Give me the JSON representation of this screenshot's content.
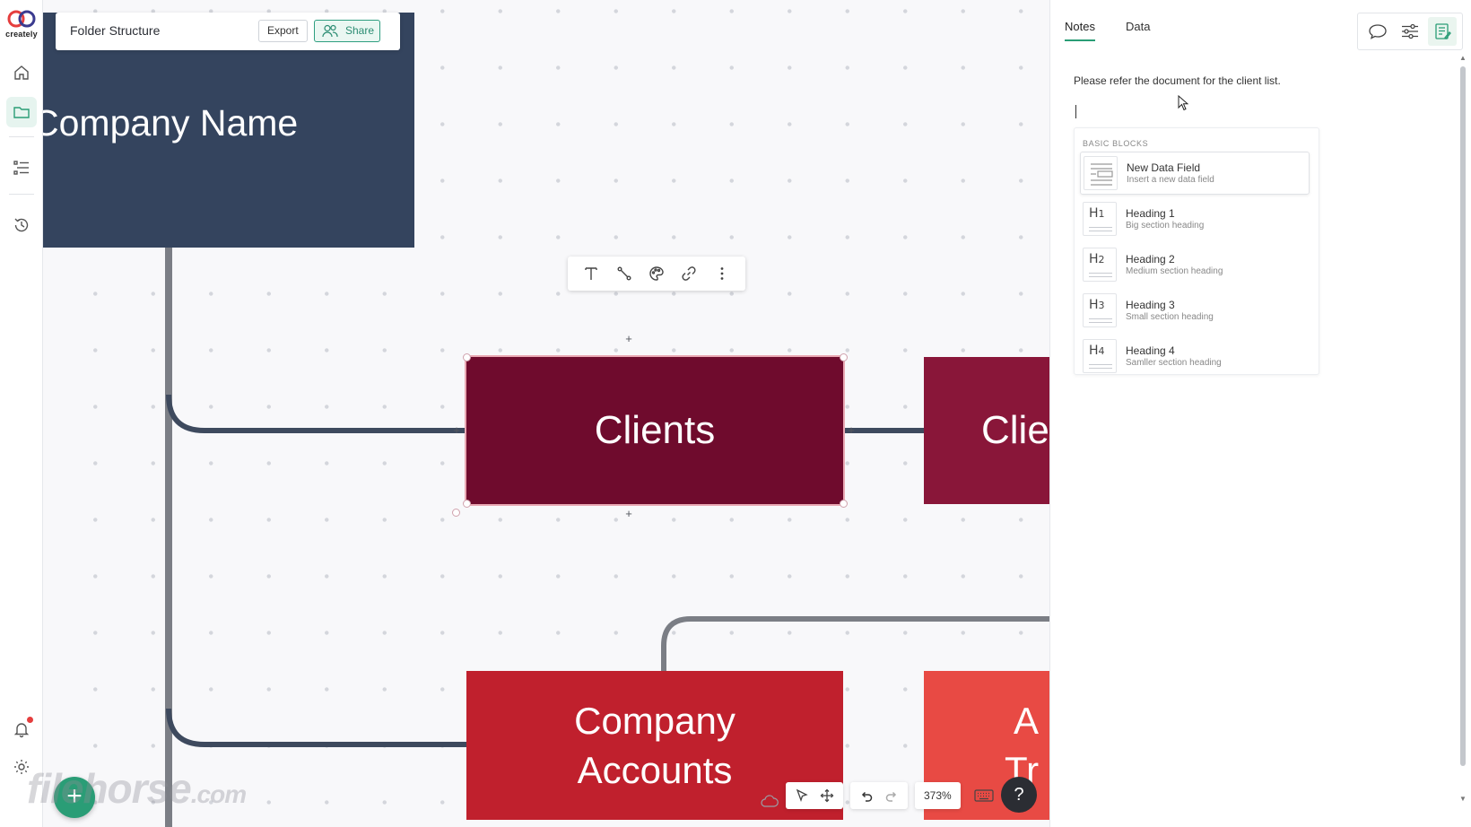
{
  "app": {
    "logo_text": "creately"
  },
  "doc": {
    "title": "Folder Structure",
    "export_label": "Export",
    "share_label": "Share"
  },
  "canvas": {
    "nodes": {
      "company": "Company Name",
      "clients": "Clients",
      "clients_partial": "Clie",
      "accounts_line1": "Company",
      "accounts_line2": "Accounts",
      "right_line1": "A",
      "right_line2": "Tr"
    },
    "zoom": "373%",
    "help": "?",
    "fab": "+",
    "watermark": "filehorse",
    "watermark_suffix": ".com"
  },
  "panel": {
    "tabs": [
      "Notes",
      "Data"
    ],
    "note": "Please refer the document for the client list.",
    "blocks_title": "BASIC BLOCKS",
    "blocks": [
      {
        "name": "New Data Field",
        "desc": "Insert a new data field",
        "icon": "data-field-icon"
      },
      {
        "name": "Heading 1",
        "desc": "Big section heading",
        "icon": "H1"
      },
      {
        "name": "Heading 2",
        "desc": "Medium section heading",
        "icon": "H2"
      },
      {
        "name": "Heading 3",
        "desc": "Small section heading",
        "icon": "H3"
      },
      {
        "name": "Heading 4",
        "desc": "Samller section heading",
        "icon": "H4"
      }
    ],
    "h_icons": {
      "h": "H",
      "n1": "1",
      "n2": "2",
      "n3": "3",
      "n4": "4"
    }
  },
  "colors": {
    "accent": "#2a9d76",
    "company": "#34445e",
    "clients": "#6f0b2d",
    "clients_alt": "#891639",
    "accounts": "#c0202d",
    "right_node": "#e84a44"
  }
}
